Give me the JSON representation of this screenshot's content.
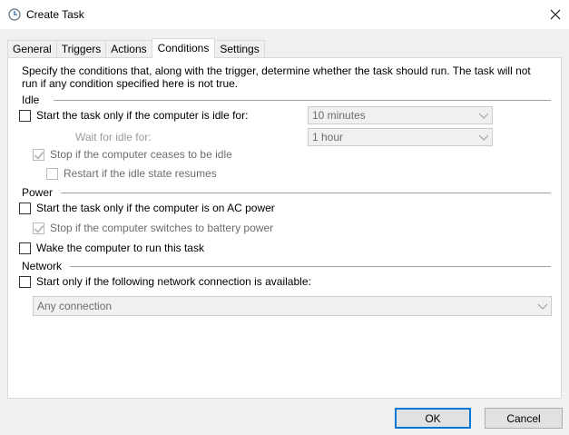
{
  "window": {
    "title": "Create Task"
  },
  "tabs": [
    "General",
    "Triggers",
    "Actions",
    "Conditions",
    "Settings"
  ],
  "active_tab": "Conditions",
  "description": "Specify the conditions that, along with the trigger, determine whether the task should run.  The task will not run  if any condition specified here is not true.",
  "idle": {
    "group": "Idle",
    "start_idle": {
      "label": "Start the task only if the computer is idle for:",
      "checked": false
    },
    "idle_duration": "10 minutes",
    "wait_label": "Wait for idle for:",
    "wait_duration": "1 hour",
    "stop_idle": {
      "label": "Stop if the computer ceases to be idle",
      "checked": true
    },
    "restart_idle": {
      "label": "Restart if the idle state resumes",
      "checked": false
    }
  },
  "power": {
    "group": "Power",
    "ac_power": {
      "label": "Start the task only if the computer is on AC power",
      "checked": false
    },
    "battery": {
      "label": "Stop if the computer switches to battery power",
      "checked": true
    },
    "wake": {
      "label": "Wake the computer to run this task",
      "checked": false
    }
  },
  "network": {
    "group": "Network",
    "start_network": {
      "label": "Start only if the following network connection is available:",
      "checked": false
    },
    "connection": "Any connection"
  },
  "buttons": {
    "ok": "OK",
    "cancel": "Cancel"
  }
}
